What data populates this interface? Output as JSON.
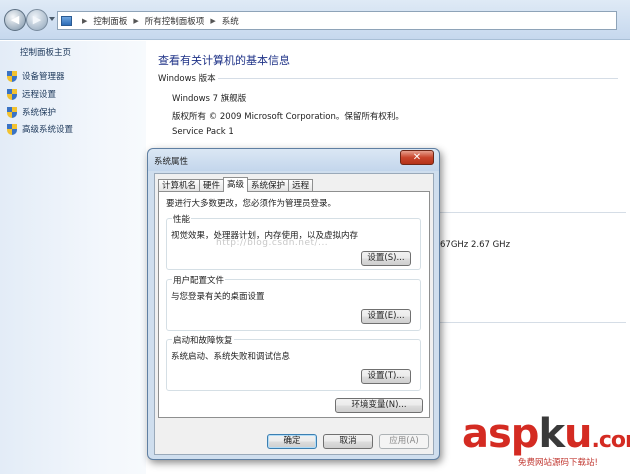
{
  "explorer": {
    "breadcrumb": [
      "控制面板",
      "所有控制面板项",
      "系统"
    ]
  },
  "sidebar": {
    "home": "控制面板主页",
    "items": [
      {
        "label": "设备管理器",
        "icon": "shield-icon"
      },
      {
        "label": "远程设置",
        "icon": "shield-icon"
      },
      {
        "label": "系统保护",
        "icon": "shield-icon"
      },
      {
        "label": "高级系统设置",
        "icon": "shield-icon"
      }
    ]
  },
  "main": {
    "title": "查看有关计算机的基本信息",
    "section_label": "Windows 版本",
    "edition": "Windows 7 旗舰版",
    "copyright": "版权所有 © 2009 Microsoft Corporation。保留所有权利。",
    "service_pack": "Service Pack 1",
    "cpu_fragment": "67GHz   2.67 GHz"
  },
  "watermark": "http://blog.csdn.net/...",
  "logo": {
    "asp": "asp",
    "k": "k",
    "u": "u",
    "dotcom": ".com",
    "subtitle": "免费网站源码下载站!"
  },
  "dialog": {
    "title": "系统属性",
    "close_symbol": "✕",
    "tabs": [
      "计算机名",
      "硬件",
      "高级",
      "系统保护",
      "远程"
    ],
    "active_tab": "高级",
    "note": "要进行大多数更改，您必须作为管理员登录。",
    "groups": [
      {
        "label": "性能",
        "desc": "视觉效果，处理器计划，内存使用，以及虚拟内存",
        "button": "设置(S)..."
      },
      {
        "label": "用户配置文件",
        "desc": "与您登录有关的桌面设置",
        "button": "设置(E)..."
      },
      {
        "label": "启动和故障恢复",
        "desc": "系统启动、系统失败和调试信息",
        "button": "设置(T)..."
      }
    ],
    "env_button": "环境变量(N)...",
    "ok": "确定",
    "cancel": "取消",
    "apply": "应用(A)"
  }
}
